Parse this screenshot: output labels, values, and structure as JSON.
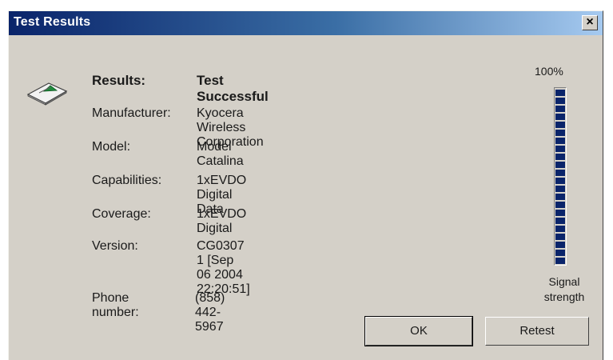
{
  "window": {
    "title": "Test Results",
    "close_label": "×"
  },
  "results": {
    "results_label": "Results:",
    "results_value": "Test Successful",
    "manufacturer_label": "Manufacturer:",
    "manufacturer_value": "Kyocera Wireless Corporation",
    "model_label": "Model:",
    "model_value": "Model Catalina",
    "capabilities_label": "Capabilities:",
    "capabilities_value": "1xEVDO Digital Data",
    "coverage_label": "Coverage:",
    "coverage_value": "1xEVDO Digital",
    "version_label": "Version:",
    "version_value": "CG0307  1  [Sep 06 2004 22:20:51]",
    "phone_label": "Phone number:",
    "phone_value": "(858) 442-5967"
  },
  "signal": {
    "percent_label": "100%",
    "caption_line1": "Signal",
    "caption_line2": "strength",
    "level_fraction": 1.0
  },
  "buttons": {
    "ok_label": "OK",
    "retest_label": "Retest"
  },
  "icons": {
    "device": "wireless-card-icon",
    "close": "close-icon"
  },
  "colors": {
    "titlebar_start": "#0a246a",
    "titlebar_end": "#a6caf0",
    "signal_fill": "#0a246a",
    "dialog_background": "#d4d0c8"
  }
}
